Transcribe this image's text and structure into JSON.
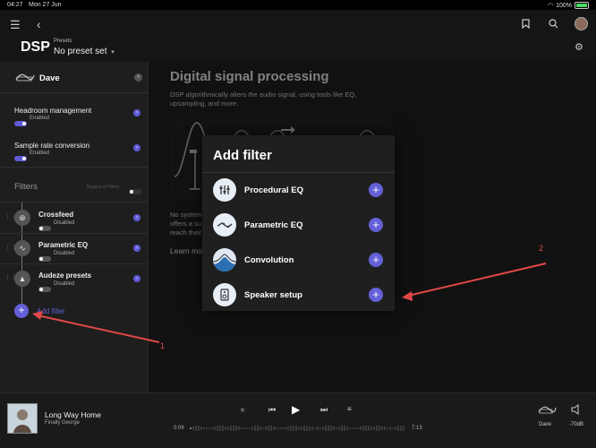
{
  "status_bar": {
    "time": "04:27",
    "date": "Mon 27 Jun",
    "battery": "100%"
  },
  "header": {
    "title": "DSP",
    "presets_label": "Presets",
    "preset_value": "No preset set"
  },
  "sidebar": {
    "device_name": "Dave",
    "headroom": {
      "label": "Headroom management",
      "state": "Enabled"
    },
    "sample_rate": {
      "label": "Sample rate conversion",
      "state": "Enabled"
    },
    "filters_title": "Filters",
    "bypass_label": "Bypass all filters",
    "filters": [
      {
        "name": "Crossfeed",
        "state": "Disabled"
      },
      {
        "name": "Parametric EQ",
        "state": "Disabled"
      },
      {
        "name": "Audeze presets",
        "state": "Disabled"
      }
    ],
    "add_filter_label": "Add filter"
  },
  "main": {
    "title": "Digital signal processing",
    "description": "DSP algorithmically alters the audio signal, using tools like EQ, upsampling, and more.",
    "partial_line1": "No system",
    "partial_line2": "offers a su",
    "partial_line3": "reach their",
    "learn_more": "Learn mo"
  },
  "modal": {
    "title": "Add filter",
    "items": [
      {
        "label": "Procedural EQ",
        "icon": "sliders-icon"
      },
      {
        "label": "Parametric EQ",
        "icon": "parametric-curve-icon"
      },
      {
        "label": "Convolution",
        "icon": "convolution-icon"
      },
      {
        "label": "Speaker setup",
        "icon": "speaker-icon"
      }
    ]
  },
  "player": {
    "track": "Long Way Home",
    "artist": "Finally George",
    "elapsed": "0:06",
    "duration": "7:13",
    "progress": 0.014,
    "device": "Dave",
    "volume": "-70dB"
  },
  "annotations": {
    "label_1": "1",
    "label_2": "2"
  },
  "colors": {
    "accent": "#6460d8",
    "annotation": "#e04848"
  }
}
